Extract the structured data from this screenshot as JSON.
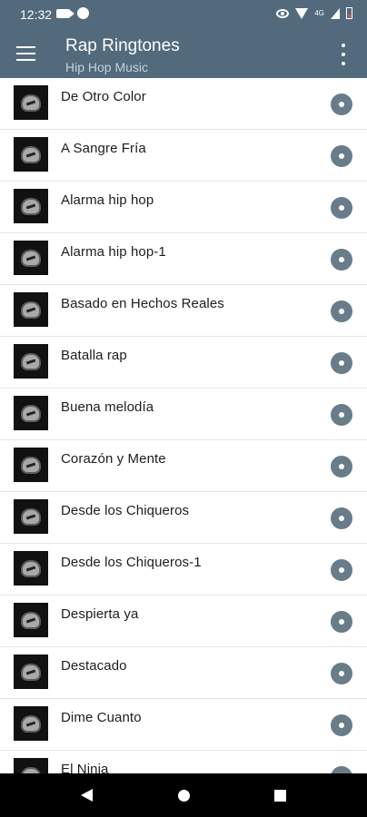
{
  "status_bar": {
    "time": "12:32",
    "icons": [
      "camera-icon",
      "notification-dot-icon",
      "data-saver-icon",
      "wifi-icon",
      "lte-signal-icon",
      "signal-icon",
      "battery-low-icon"
    ],
    "network_label": "4G"
  },
  "app_bar": {
    "title": "Rap Ringtones",
    "subtitle": "Hip Hop Music",
    "menu_icon": "hamburger-menu-icon",
    "more_icon": "more-vert-icon"
  },
  "ringtones": [
    {
      "title": " De Otro Color"
    },
    {
      "title": "A Sangre Fría"
    },
    {
      "title": "Alarma hip hop"
    },
    {
      "title": "Alarma hip hop-1"
    },
    {
      "title": "Basado en Hechos Reales"
    },
    {
      "title": "Batalla rap"
    },
    {
      "title": "Buena melodía"
    },
    {
      "title": "Corazón y Mente"
    },
    {
      "title": "Desde los Chiqueros"
    },
    {
      "title": "Desde los Chiqueros-1"
    },
    {
      "title": "Despierta ya"
    },
    {
      "title": "Destacado"
    },
    {
      "title": "Dime Cuanto"
    },
    {
      "title": "El Ninja"
    }
  ],
  "colors": {
    "app_bar": "#526a7b",
    "play_button": "#687c89",
    "navigation_bar": "#000000"
  },
  "navigation": {
    "back_icon": "back-triangle-icon",
    "home_icon": "home-circle-icon",
    "recent_icon": "recent-apps-square-icon"
  }
}
